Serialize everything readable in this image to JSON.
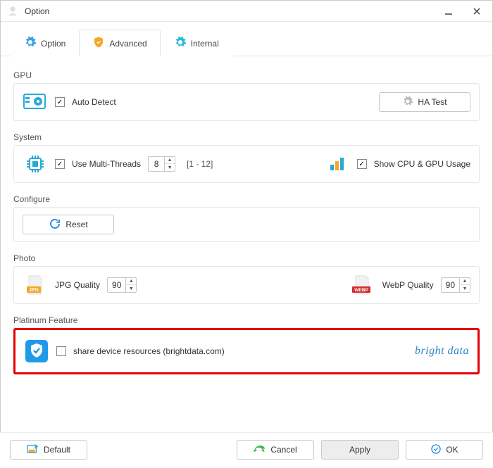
{
  "window": {
    "title": "Option"
  },
  "tabs": {
    "option": "Option",
    "advanced": "Advanced",
    "internal": "Internal",
    "active_index": 1
  },
  "gpu": {
    "section_label": "GPU",
    "auto_detect_label": "Auto Detect",
    "auto_detect_checked": true,
    "ha_test_label": "HA Test"
  },
  "system": {
    "section_label": "System",
    "use_multi_threads_label": "Use Multi-Threads",
    "use_multi_threads_checked": true,
    "threads_value": "8",
    "threads_range": "[1 - 12]",
    "show_cpu_gpu_label": "Show CPU & GPU Usage",
    "show_cpu_gpu_checked": true
  },
  "configure": {
    "section_label": "Configure",
    "reset_label": "Reset"
  },
  "photo": {
    "section_label": "Photo",
    "jpg_quality_label": "JPG Quality",
    "jpg_quality_value": "90",
    "webp_quality_label": "WebP Quality",
    "webp_quality_value": "90",
    "jpg_badge": "JPG",
    "webp_badge": "WEBP"
  },
  "platinum": {
    "section_label": "Platinum Feature",
    "share_label": "share device resources (brightdata.com)",
    "share_checked": false,
    "brand_text": "bright data"
  },
  "footer": {
    "default_label": "Default",
    "cancel_label": "Cancel",
    "apply_label": "Apply",
    "ok_label": "OK"
  }
}
